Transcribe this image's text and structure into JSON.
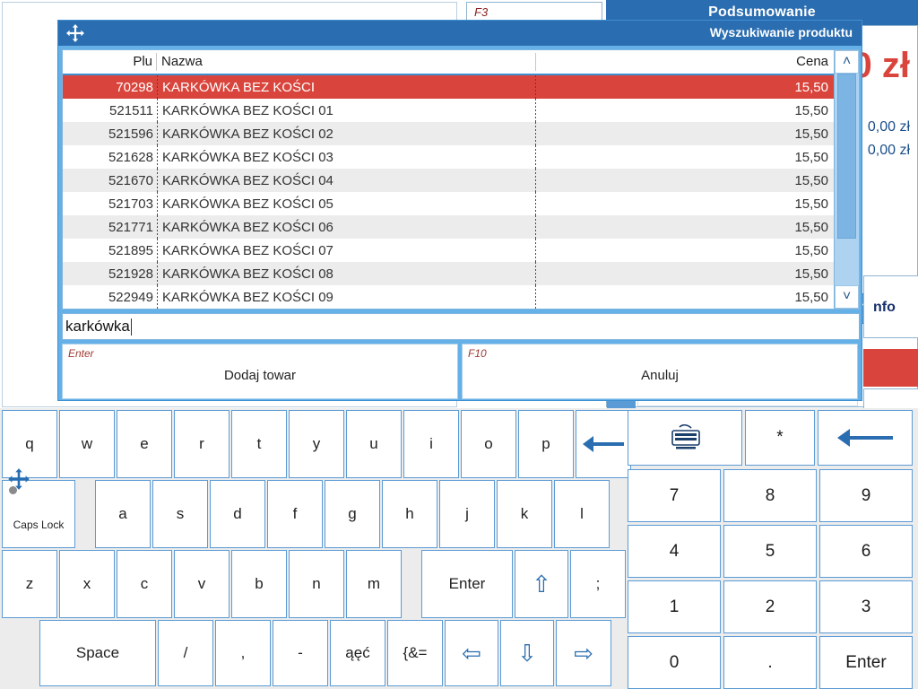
{
  "background": {
    "f3_hotkey": "F3",
    "summary_header": "Podsumowanie",
    "total_amount": "0 zł",
    "subtotal_1": "0,00 zł",
    "subtotal_2": "0,00 zł",
    "info_label": "nfo",
    "check_icon": "✔",
    "colors": {
      "header_blue": "#2a6db0",
      "accent_red": "#d9453c",
      "amount_blue": "#1a4f8a"
    }
  },
  "dialog": {
    "title": "Wyszukiwanie produktu",
    "move_handle_icon": "move-arrows-icon",
    "columns": [
      "Plu",
      "Nazwa",
      "Cena"
    ],
    "rows": [
      {
        "plu": "70298",
        "nazwa": "KARKÓWKA BEZ KOŚCI",
        "cena": "15,50",
        "selected": true
      },
      {
        "plu": "521511",
        "nazwa": "KARKÓWKA BEZ KOŚCI 01",
        "cena": "15,50",
        "selected": false
      },
      {
        "plu": "521596",
        "nazwa": "KARKÓWKA BEZ KOŚCI 02",
        "cena": "15,50",
        "selected": false
      },
      {
        "plu": "521628",
        "nazwa": "KARKÓWKA BEZ KOŚCI 03",
        "cena": "15,50",
        "selected": false
      },
      {
        "plu": "521670",
        "nazwa": "KARKÓWKA BEZ KOŚCI 04",
        "cena": "15,50",
        "selected": false
      },
      {
        "plu": "521703",
        "nazwa": "KARKÓWKA BEZ KOŚCI 05",
        "cena": "15,50",
        "selected": false
      },
      {
        "plu": "521771",
        "nazwa": "KARKÓWKA BEZ KOŚCI 06",
        "cena": "15,50",
        "selected": false
      },
      {
        "plu": "521895",
        "nazwa": "KARKÓWKA BEZ KOŚCI 07",
        "cena": "15,50",
        "selected": false
      },
      {
        "plu": "521928",
        "nazwa": "KARKÓWKA BEZ KOŚCI 08",
        "cena": "15,50",
        "selected": false
      },
      {
        "plu": "522949",
        "nazwa": "KARKÓWKA BEZ KOŚCI 09",
        "cena": "15,50",
        "selected": false
      }
    ],
    "scrollbar": {
      "up_icon": "˄",
      "down_icon": "˅"
    },
    "search": {
      "value": "karkówka",
      "placeholder": ""
    },
    "buttons": [
      {
        "hotkey": "Enter",
        "caption": "Dodaj towar"
      },
      {
        "hotkey": "F10",
        "caption": "Anuluj"
      }
    ]
  },
  "keyboard": {
    "row1": [
      "q",
      "w",
      "e",
      "r",
      "t",
      "y",
      "u",
      "i",
      "o",
      "p"
    ],
    "row1_backspace": "←",
    "caps_lock": "Caps Lock",
    "row2": [
      "a",
      "s",
      "d",
      "f",
      "g",
      "h",
      "j",
      "k",
      "l"
    ],
    "row3": [
      "z",
      "x",
      "c",
      "v",
      "b",
      "n",
      "m"
    ],
    "row3_enter": "Enter",
    "row3_shift": "⇧",
    "row3_semicolon": ";",
    "move_handle_icon": "move-arrows-icon",
    "row4_space": "Space",
    "row4": [
      "/",
      ",",
      "-",
      "ąęć",
      "{&="
    ],
    "row4_left": "⇦",
    "row4_down": "⇩",
    "row4_right": "⇨"
  },
  "numpad": {
    "keyboard_toggle_icon": "keyboard-icon",
    "star": "*",
    "backspace": "←",
    "keys": [
      "7",
      "8",
      "9",
      "4",
      "5",
      "6",
      "1",
      "2",
      "3",
      "0",
      "."
    ],
    "enter": "Enter"
  }
}
